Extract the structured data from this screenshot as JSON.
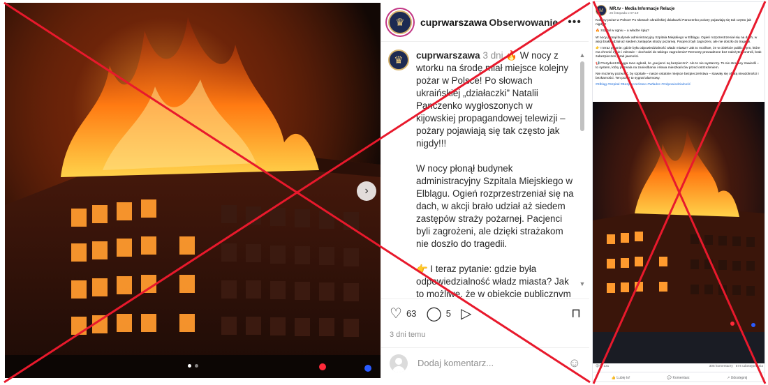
{
  "instagram": {
    "username": "cuprwarszawa",
    "follow_label": "Obserwowanie",
    "menu_glyph": "•••",
    "avatar_glyph": "♛",
    "caption_time": "3 dni",
    "caption_paragraphs": [
      "🔥 W nocy z wtorku na środę miał miejsce kolejny pożar w Polsce! Po słowach ukraińskiej „działaczki” Natalii Panczenko wygłoszonych w kijowskiej propagandowej telewizji – pożary pojawiają się tak często jak nigdy!!!",
      "W nocy płonął budynek administracyjny Szpitala Miejskiego w Elblągu. Ogień rozprzestrzeniał się na dach, w akcji brało udział aż siedem zastępów straży pożarnej. Pacjenci byli zagrożeni, ale dzięki strażakom nie doszło do tragedii.",
      "👉 I teraz pytanie: gdzie była odpowiedzialność władz miasta? Jak to możliwe, że w obiekcie publicznym – miejscu, które ma chronić życie i zdrowie – dochodzi do takiego zagrożenia?"
    ],
    "likes": "63",
    "comments": "5",
    "posted": "3 dni temu",
    "comment_placeholder": "Dodaj komentarz...",
    "next_glyph": "›",
    "icons": {
      "like": "♡",
      "comment": "◯",
      "share": "▷",
      "bookmark": "⊓",
      "emoji": "☺",
      "scroll_up": "▲",
      "scroll_down": "▼"
    }
  },
  "facebook": {
    "page_name": "MR.tv - Media Informacje Relacje",
    "date": "26 listopada o 07:19",
    "avatar_glyph": "M",
    "paragraphs": [
      "Kolejny pożar w Polsce! Po słowach ukraińskiej działaczki Panczenko pożary pojawiają się tak często jak nigdy!!!",
      "🔥 Szpital w ogniu – a władze śpią?",
      "W nocy płonął budynek administracyjny Szpitala Miejskiego w Elblągu. Ogień rozprzestrzeniał się na dach, w akcji brało udział aż siedem zastępów straży pożarnej. Pacjenci byli zagrożeni, ale nie doszło do tragedii.",
      "👉 I teraz pytanie: gdzie była odpowiedzialność władz miasta? Jak to możliwe, że w obiekcie publicznym, które ma chronić życie i zdrowie – dochodzi do takiego zagrożenia? Remonty prowadzone bez należytej kontroli, brak zabezpieczeń, brak jawności.",
      "📢 Prezydent Elbląga rano ogłosił, że „pacjenci są bezpieczni”. Ale to nie wystarczy. To nie strażacy zawiedli – to system, który pozwala na zaniedbania i słowa mieszkańców przed ostrzeżeniem.",
      "Nie możemy pozwolić, by szpitale – nasze ostatnie miejsce bezpieczeństwa – stawały się ofiarą nieudolności i bezkarności. Ten pożar to sygnał alarmowy."
    ],
    "hashtags": "#Elbląg #Szpital #Bezpieczeństwo #Władze #Odpowiedzialność",
    "reaction_count": "😮😡 131",
    "comment_count": "305 komentarzy",
    "share_count": "574 udostępnienia",
    "actions": [
      "👍 Lubię to!",
      "💬 Komentarz",
      "↗ Udostępnij"
    ]
  },
  "colors": {
    "cross": "#e8192c",
    "fire": "#ff7a12",
    "link": "#216fdb"
  }
}
